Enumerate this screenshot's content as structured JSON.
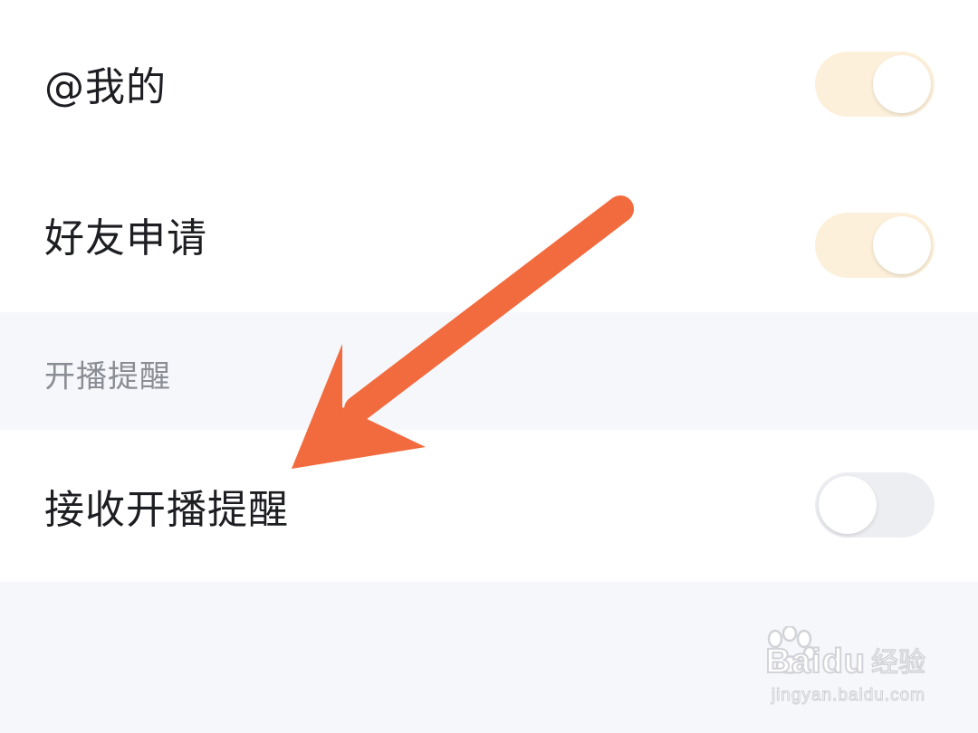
{
  "settings": {
    "rows_top": [
      {
        "label": "@我的",
        "toggle_on": true
      },
      {
        "label": "好友申请",
        "toggle_on": true
      }
    ],
    "section": {
      "title": "开播提醒",
      "rows": [
        {
          "label": "接收开播提醒",
          "toggle_on": false
        }
      ]
    }
  },
  "colors": {
    "toggle_on_track": "#fdf0da",
    "toggle_off_track": "#eceef2",
    "annotation_arrow": "#f26b3f",
    "page_background": "#f6f7fa"
  },
  "overlay": {
    "annotation": "arrow pointing to 接收开播提醒",
    "watermark": {
      "brand": "Baidu",
      "sub": "经验",
      "url": "jingyan.baidu.com"
    }
  }
}
